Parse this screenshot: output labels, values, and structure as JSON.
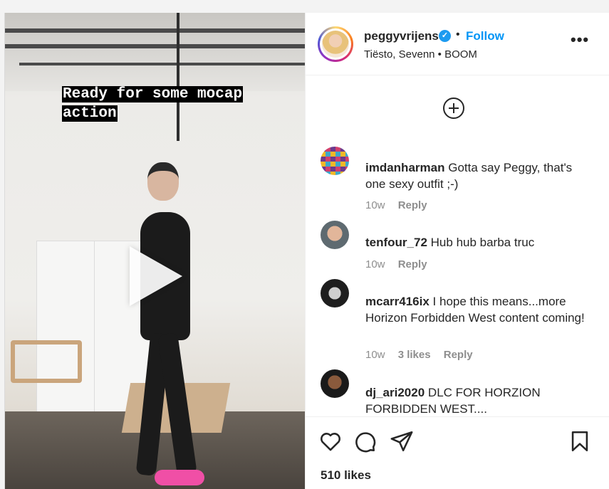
{
  "video": {
    "caption_line1": "Ready for some mocap",
    "caption_line2": "action"
  },
  "header": {
    "username": "peggyvrijens",
    "verified": "✓",
    "separator": "•",
    "follow_label": "Follow",
    "audio": "Tiësto, Sevenn • BOOM",
    "more": "•••"
  },
  "comments": [
    {
      "user": "imdanharman",
      "text": "Gotta say Peggy, that's one sexy outfit ;-)",
      "time": "10w",
      "likes": "",
      "reply": "Reply"
    },
    {
      "user": "tenfour_72",
      "text": "Hub hub barba truc",
      "time": "10w",
      "likes": "",
      "reply": "Reply"
    },
    {
      "user": "mcarr416ix",
      "text": "I hope this means...more Horizon Forbidden West content coming!",
      "time": "10w",
      "likes": "3 likes",
      "reply": "Reply"
    },
    {
      "user": "dj_ari2020",
      "text": "DLC FOR HORZION FORBIDDEN WEST....",
      "time": "",
      "likes": "",
      "reply": ""
    }
  ],
  "footer": {
    "likes": "510 likes"
  },
  "icons": {
    "like": "heart-icon",
    "comment": "comment-icon",
    "share": "share-icon",
    "save": "bookmark-icon",
    "add": "add-comment-icon"
  },
  "colors": {
    "accent": "#0095f6",
    "verified": "#1d9bf0",
    "muted": "#8e8e8e",
    "text": "#262626"
  }
}
